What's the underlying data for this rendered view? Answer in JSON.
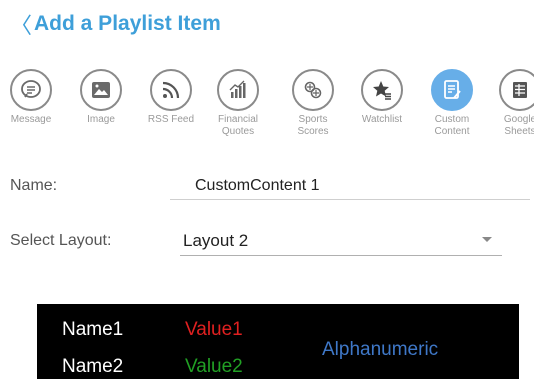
{
  "header": {
    "back_icon": "〈",
    "title": "Add a Playlist Item"
  },
  "content_types": [
    {
      "icon": "message-icon",
      "label": [
        "Message"
      ]
    },
    {
      "icon": "image-icon",
      "label": [
        "Image"
      ]
    },
    {
      "icon": "rss-icon",
      "label": [
        "RSS Feed"
      ]
    },
    {
      "icon": "financial-quotes-icon",
      "label": [
        "Financial",
        "Quotes"
      ]
    },
    {
      "icon": "sports-scores-icon",
      "label": [
        "Sports",
        "Scores"
      ]
    },
    {
      "icon": "watchlist-icon",
      "label": [
        "Watchlist"
      ]
    },
    {
      "icon": "custom-content-icon",
      "label": [
        "Custom",
        "Content"
      ],
      "selected": true
    },
    {
      "icon": "google-sheets-icon",
      "label": [
        "Google",
        "Sheets"
      ]
    }
  ],
  "form": {
    "name_label": "Name:",
    "name_value": "CustomContent 1",
    "layout_label": "Select Layout:",
    "layout_value": "Layout 2"
  },
  "preview": {
    "name1": "Name1",
    "value1": "Value1",
    "name2": "Name2",
    "value2": "Value2",
    "alphanumeric": "Alphanumeric"
  },
  "colors": {
    "accent": "#3e9fd9",
    "selected_icon_bg": "#67aee8",
    "value1": "#e02020",
    "value2": "#21a024",
    "alphanumeric": "#3f78c8"
  }
}
